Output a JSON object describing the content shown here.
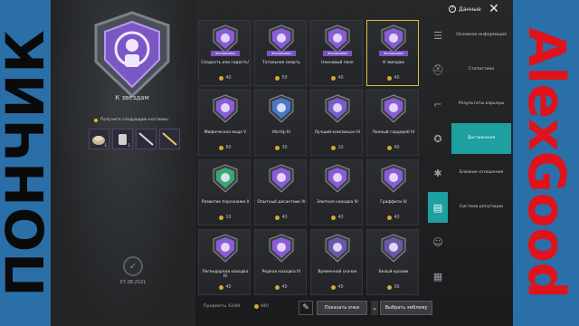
{
  "overlay": {
    "left_text": "ПОНЧИК",
    "right_text": "AlexGood"
  },
  "topbar": {
    "data_label": "Данные",
    "close": "✕"
  },
  "hero": {
    "title": "К звездам",
    "reward_note": "Получите следующие костюмы:",
    "reward_counts": [
      "1",
      "1",
      "",
      ""
    ],
    "date": "07.08.2021"
  },
  "grid": {
    "cards": [
      {
        "name": "Сладость или гадость!",
        "points": "40",
        "owned_label": "Экипирован",
        "owned": true,
        "color": "#8a5cd6",
        "icon": "ghost-icon"
      },
      {
        "name": "Тотальная смерть",
        "points": "50",
        "owned_label": "Экипирован",
        "owned": true,
        "color": "#8a5cd6",
        "icon": "skull-icon"
      },
      {
        "name": "Неоновый панк",
        "points": "40",
        "owned_label": "Экипирован",
        "owned": true,
        "color": "#8a5cd6",
        "icon": "punk-icon"
      },
      {
        "name": "К звездам",
        "points": "40",
        "owned_label": "Экипирован",
        "owned": true,
        "color": "#8a5cd6",
        "icon": "astronaut-icon",
        "selected": true
      },
      {
        "name": "Мифическая мода V",
        "points": "60",
        "owned": false,
        "color": "#8a5cd6",
        "icon": "suit-icon"
      },
      {
        "name": "Матёр III",
        "points": "30",
        "owned": false,
        "color": "#4a78c8",
        "icon": "rifle-icon"
      },
      {
        "name": "Лучший компаньон IV",
        "points": "20",
        "owned": false,
        "color": "#7a5cc8",
        "icon": "eagle-icon"
      },
      {
        "name": "Полный гардероб IV",
        "points": "40",
        "owned": false,
        "color": "#8a5cd6",
        "icon": "wardrobe-icon"
      },
      {
        "name": "Развитие персонажа II",
        "points": "10",
        "owned": false,
        "color": "#3aa672",
        "icon": "person-icon"
      },
      {
        "name": "Опытный десантник IV",
        "points": "40",
        "owned": false,
        "color": "#8a5cd6",
        "icon": "parachute-icon"
      },
      {
        "name": "Элитная находка IV",
        "points": "40",
        "owned": false,
        "color": "#8a5cd6",
        "icon": "shirt-icon"
      },
      {
        "name": "Граффити IV",
        "points": "40",
        "owned": false,
        "color": "#8a5cd6",
        "icon": "spray-icon"
      },
      {
        "name": "Легендарная находка IV",
        "points": "40",
        "owned": false,
        "color": "#8a5cd6",
        "icon": "jacket-icon"
      },
      {
        "name": "Редкая находка IV",
        "points": "40",
        "owned": false,
        "color": "#8a5cd6",
        "icon": "vest-icon"
      },
      {
        "name": "Временной скачок",
        "points": "40",
        "owned": false,
        "color": "#6a58a8",
        "icon": "clock-icon"
      },
      {
        "name": "Белый кролик",
        "points": "50",
        "owned": false,
        "color": "#6a58a8",
        "icon": "rabbit-icon"
      }
    ]
  },
  "sidebar_icons": [
    "list-icon",
    "helmet-icon",
    "pistol-icon",
    "medal-icon",
    "bodybuilder-icon",
    "chat-icon",
    "friends-icon",
    "grid-icon"
  ],
  "menu": {
    "items": [
      {
        "label": "Основная информация"
      },
      {
        "label": "Статистика"
      },
      {
        "label": "Результаты карьеры"
      },
      {
        "label": "Достижения",
        "active": true
      },
      {
        "label": "Близкие отношения"
      },
      {
        "label": "Система репутации"
      }
    ]
  },
  "bottom": {
    "achievements_label": "Предметы",
    "achievements_count": "43/49",
    "points_total": "940",
    "show_points_button": "Показать очки",
    "choose_emblem_button": "Выбрать эмблему"
  }
}
